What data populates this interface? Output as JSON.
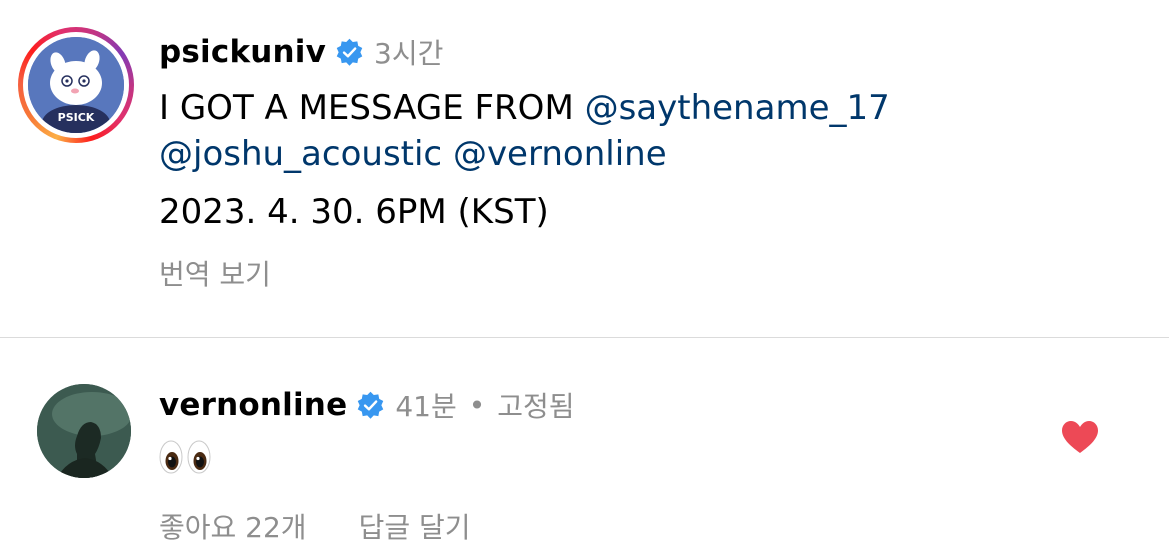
{
  "post": {
    "username": "psickuniv",
    "time": "3시간",
    "avatar_text": "PSICK",
    "caption": {
      "text_start": "I GOT A MESSAGE FROM ",
      "mentions": [
        "@saythename_17",
        "@joshu_acoustic",
        "@vernonline"
      ],
      "date_line": "2023. 4. 30. 6PM (KST)"
    },
    "translate_label": "번역 보기"
  },
  "comment": {
    "username": "vernonline",
    "time": "41분",
    "separator": "•",
    "pinned_label": "고정됨",
    "likes_label": "좋아요 22개",
    "reply_label": "답글 달기",
    "liked": true
  },
  "colors": {
    "verified": "#3897f0",
    "mention": "#00376b",
    "heart": "#ed4956",
    "muted": "#8e8e8e"
  },
  "icons": {
    "verified": "verified-badge-icon",
    "heart": "heart-icon",
    "emoji": "eyes-emoji"
  }
}
